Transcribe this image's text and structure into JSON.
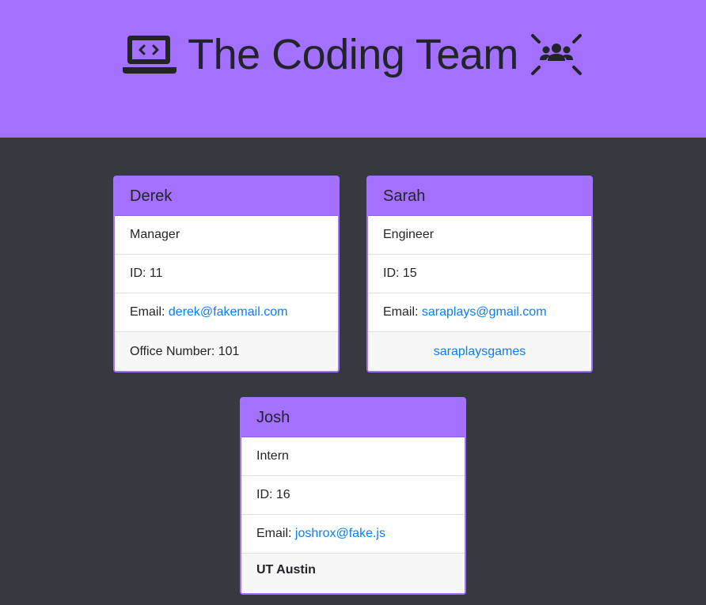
{
  "header": {
    "title": "The Coding Team",
    "left_icon": "laptop-code-icon",
    "right_icon": "team-icon",
    "background_color": "#a370ff"
  },
  "page": {
    "background_color": "#343a40"
  },
  "cards": [
    {
      "name": "Derek",
      "role": "Manager",
      "id_label": "ID: 11",
      "email_label": "Email: ",
      "email": "derek@fakemail.com",
      "extra": "Office Number: 101"
    },
    {
      "name": "Sarah",
      "role": "Engineer",
      "id_label": "ID: 15",
      "email_label": "Email: ",
      "email": "saraplays@gmail.com",
      "extra": "saraplaysgames"
    },
    {
      "name": "Josh",
      "role": "Intern",
      "id_label": "ID: 16",
      "email_label": "Email: ",
      "email": "joshrox@fake.js",
      "extra": "UT Austin"
    }
  ],
  "colors": {
    "accent": "#a370ff",
    "link": "#0a7cff",
    "text": "#212529"
  }
}
